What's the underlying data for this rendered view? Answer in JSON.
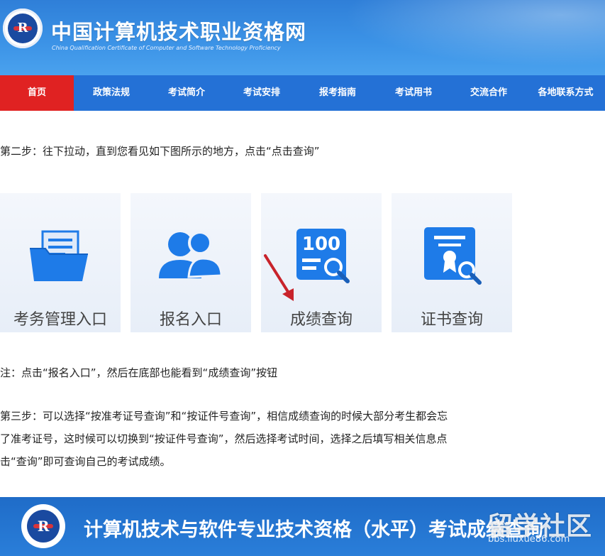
{
  "header": {
    "title": "中国计算机技术职业资格网",
    "subtitle": "China Qualification Certificate of Computer and Software Technology Proficiency",
    "logo_letter": "R"
  },
  "nav": [
    {
      "label": "首页",
      "active": true
    },
    {
      "label": "政策法规",
      "active": false
    },
    {
      "label": "考试简介",
      "active": false
    },
    {
      "label": "考试安排",
      "active": false
    },
    {
      "label": "报考指南",
      "active": false
    },
    {
      "label": "考试用书",
      "active": false
    },
    {
      "label": "交流合作",
      "active": false
    },
    {
      "label": "各地联系方式",
      "active": false
    }
  ],
  "content": {
    "step2": "第二步：往下拉动，直到您看见如下图所示的地方，点击“点击查询”",
    "note": "注：点击“报名入口”，然后在底部也能看到“成绩查询”按钮",
    "step3": [
      "第三步：可以选择“按准考证号查询”和“按证件号查询”，相信成绩查询的时候大部分考生都会忘",
      "了准考证号，这时候可以切换到“按证件号查询”，然后选择考试时间，选择之后填写相关信息点",
      "击“查询”即可查询自己的考试成绩。"
    ]
  },
  "tiles": [
    {
      "label": "考务管理入口",
      "icon": "folder-icon"
    },
    {
      "label": "报名入口",
      "icon": "users-icon"
    },
    {
      "label": "成绩查询",
      "icon": "score-search-icon",
      "badge": "100"
    },
    {
      "label": "证书查询",
      "icon": "certificate-search-icon"
    }
  ],
  "bottom_banner": {
    "title": "计算机技术与软件专业技术资格（水平）考试成绩查询",
    "logo_letter": "R"
  },
  "watermark": {
    "text": "留学社区",
    "url": "bbs.liuxue86.com"
  },
  "colors": {
    "nav_bg": "#2471d6",
    "nav_active": "#e02222",
    "icon_blue": "#1e7be8",
    "arrow_red": "#c8232b"
  }
}
